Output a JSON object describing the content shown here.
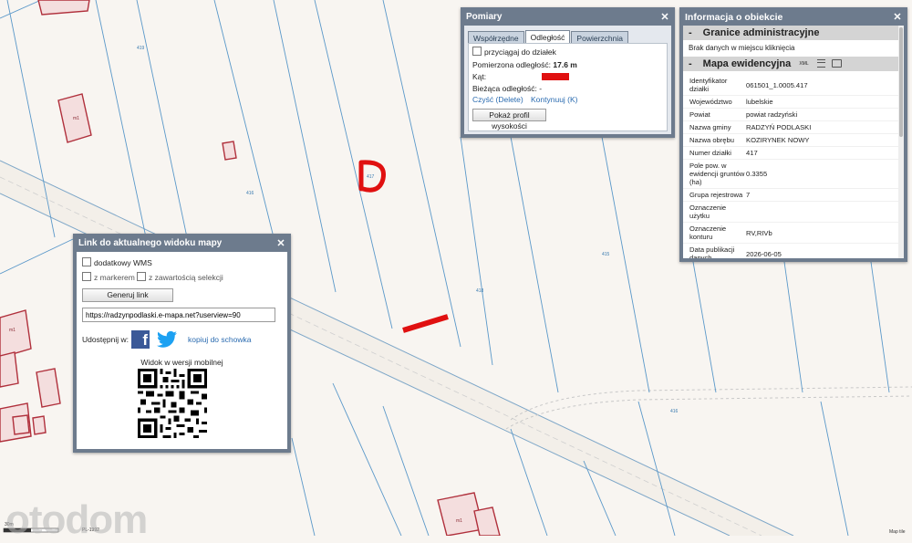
{
  "map": {
    "parcel_labels": [
      "417",
      "418",
      "419",
      "417",
      "416",
      "415",
      "416"
    ],
    "house_label": "m1",
    "scale_text": "30m",
    "crs_text": "PL-1992",
    "credit_text": "Map tile",
    "watermark": "otodom",
    "parcel_line_color": "#5a98c9",
    "building_color": "#b0303c",
    "road_color": "#7ea7c8",
    "highlight_color": "#e01010"
  },
  "measure_panel": {
    "title": "Pomiary",
    "tabs": [
      "Współrzędne",
      "Odległość",
      "Powierzchnia"
    ],
    "active_tab": "Odległość",
    "snap_label": "przyciągaj do działek",
    "measured_label": "Pomierzona odległość:",
    "measured_value": "17.6 m",
    "angle_label": "Kąt:",
    "current_label": "Bieżąca odległość: -",
    "clear_link": "Czyść (Delete)",
    "continue_link": "Kontynuuj (K)",
    "profile_button": "Pokaż profil wysokości"
  },
  "info_panel": {
    "title": "Informacja o obiekcie",
    "admin_header": "Granice administracyjne",
    "admin_text": "Brak danych w miejscu kliknięcia",
    "register_header": "Mapa ewidencyjna",
    "xml_label": "XML",
    "rows": [
      {
        "k": "Identyfikator działki",
        "v": "061501_1.0005.417"
      },
      {
        "k": "Województwo",
        "v": "lubelskie"
      },
      {
        "k": "Powiat",
        "v": "powiat radzyński"
      },
      {
        "k": "Nazwa gminy",
        "v": "RADZYŃ PODLASKI"
      },
      {
        "k": "Nazwa obrębu",
        "v": "KOZIRYNEK NOWY"
      },
      {
        "k": "Numer działki",
        "v": "417"
      },
      {
        "k": "Pole pow. w ewidencji gruntów (ha)",
        "v": "0.3355"
      },
      {
        "k": "Grupa rejestrowa",
        "v": "7"
      },
      {
        "k": "Oznaczenie użytku",
        "v": ""
      },
      {
        "k": "Oznaczenie konturu",
        "v": "RV,RIVb"
      },
      {
        "k": "Data publikacji danych",
        "v": "2026-06-05"
      }
    ]
  },
  "link_panel": {
    "title": "Link do aktualnego widoku mapy",
    "wms_label": "dodatkowy WMS",
    "marker_label": "z markerem",
    "selection_label": "z zawartością selekcji",
    "generate_button": "Generuj link",
    "url_value": "https://radzynpodlaski.e-mapa.net?userview=90",
    "share_label": "Udostępnij w:",
    "copy_link": "kopiuj do schowka",
    "mobile_label": "Widok w wersji mobilnej"
  }
}
